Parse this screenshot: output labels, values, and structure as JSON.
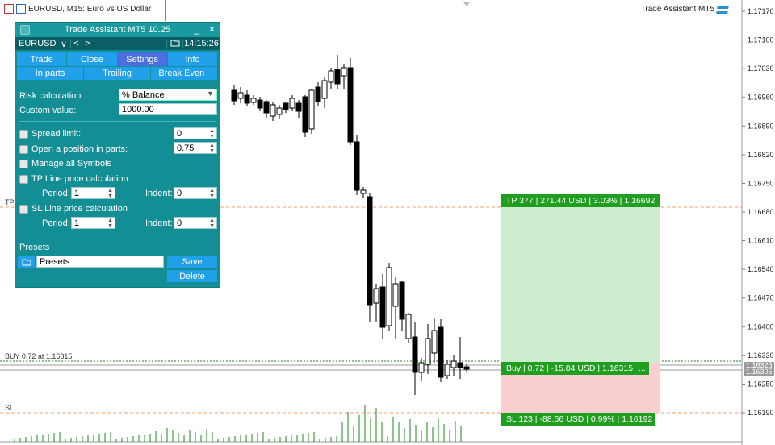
{
  "chart": {
    "symbol_title": "EURUSD, M15:  Euro vs US Dollar",
    "ea_name": "Trade Assistant MT5",
    "buy_line_label": "BUY 0.72 at 1.16315",
    "tp_marker": "TP",
    "sl_marker": "SL",
    "price_axis": [
      "1.17170",
      "1.17100",
      "1.17030",
      "1.16960",
      "1.16890",
      "1.16820",
      "1.16750",
      "1.16680",
      "1.16610",
      "1.16540",
      "1.16470",
      "1.16400",
      "1.16330",
      "1.16250",
      "1.16190"
    ],
    "price_tags": [
      "1.16325",
      "1.16305"
    ],
    "colors": {
      "bull": "#000000",
      "bear": "#000000",
      "tp_zone": "#cdeccd",
      "sl_zone": "#f9cfcf",
      "label_bg": "#1f9e1f",
      "volume": "#1a8a1a"
    }
  },
  "trade": {
    "tp_label": "TP 377 | 271.44 USD | 3.03% | 1.16692",
    "entry_label": "Buy | 0.72 | -15.84 USD | 1.16315",
    "entry_more": "...",
    "sl_label": "SL 123 | -88.56 USD | 0.99% | 1.16192"
  },
  "panel": {
    "title": "Trade Assistant MT5 10.25",
    "minimize": "_",
    "close": "×",
    "symbol": "EURUSD",
    "symbol_chev": "∨",
    "prev": "<",
    "next": ">",
    "folder_icon": "folder-icon",
    "time": "14:15:26",
    "tabs": [
      "Trade",
      "Close",
      "Settings",
      "Info"
    ],
    "active_tab": "Settings",
    "subtabs": [
      "In parts",
      "Trailing",
      "Break Even+"
    ],
    "risk_label": "Risk calculation:",
    "risk_value": "% Balance",
    "custom_label": "Custom value:",
    "custom_value": "1000.00",
    "spread_label": "Spread limit:",
    "spread_value": "0",
    "parts_label": "Open a position in parts:",
    "parts_value": "0.75",
    "manage_label": "Manage all Symbols",
    "tp_calc_label": "TP Line price calculation",
    "tp_period_label": "Period:",
    "tp_period_value": "1",
    "tp_indent_label": "Indent:",
    "tp_indent_value": "0",
    "sl_calc_label": "SL Line price calculation",
    "sl_period_label": "Period:",
    "sl_period_value": "1",
    "sl_indent_label": "Indent:",
    "sl_indent_value": "0",
    "presets_label": "Presets",
    "presets_value": "Presets",
    "save_label": "Save",
    "delete_label": "Delete"
  }
}
